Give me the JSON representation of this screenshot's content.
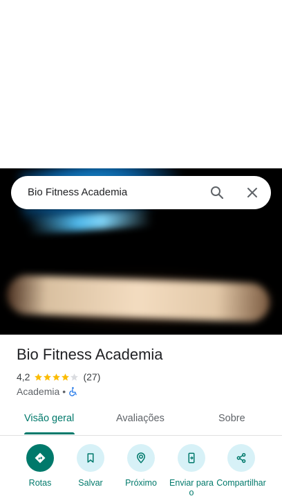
{
  "search": {
    "query": "Bio Fitness Academia"
  },
  "place": {
    "name": "Bio Fitness Academia",
    "rating": "4,2",
    "stars": 4,
    "review_count": "(27)",
    "category": "Academia",
    "separator": "•"
  },
  "tabs": [
    {
      "label": "Visão geral",
      "active": true
    },
    {
      "label": "Avaliações",
      "active": false
    },
    {
      "label": "Sobre",
      "active": false
    }
  ],
  "actions": [
    {
      "label": "Rotas",
      "icon": "directions-icon"
    },
    {
      "label": "Salvar",
      "icon": "bookmark-icon"
    },
    {
      "label": "Próximo",
      "icon": "nearby-icon"
    },
    {
      "label": "Enviar para o",
      "icon": "send-to-phone-icon"
    },
    {
      "label": "Compartilhar",
      "icon": "share-icon"
    }
  ],
  "colors": {
    "accent": "#00796b",
    "chip_bg": "#d7f1f7",
    "star": "#fbbc04"
  }
}
